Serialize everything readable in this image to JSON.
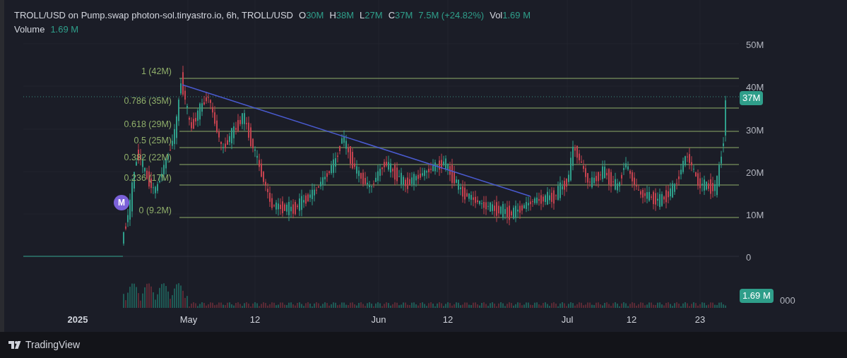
{
  "legend": {
    "title": "TROLL/USD on Pump.swap photon-sol.tinyastro.io, 6h, TROLL/USD",
    "ohlc": [
      {
        "label": "O",
        "value": "30M"
      },
      {
        "label": "H",
        "value": "38M"
      },
      {
        "label": "L",
        "value": "27M"
      },
      {
        "label": "C",
        "value": "37M"
      }
    ],
    "change": "7.5M (+24.82%)",
    "volume": {
      "label": "Vol",
      "value": "1.69 M"
    }
  },
  "volume_legend": {
    "label": "Volume",
    "value": "1.69 M"
  },
  "y_axis": [
    "50M",
    "40M",
    "30M",
    "20M",
    "10M",
    "0"
  ],
  "fib_levels": [
    "1 (42M)",
    "0.786 (35M)",
    "0.618 (29M)",
    "0.5 (25M)",
    "0.382 (22M)",
    "0.236 (17M)",
    "0 (9.2M)"
  ],
  "price_badge": "37M",
  "volume_badge": "1.69 M",
  "volume_axis_tail": "000",
  "marker": "M",
  "x_axis": [
    "2025",
    "May",
    "12",
    "Jun",
    "12",
    "Jul",
    "12",
    "23"
  ],
  "footer": {
    "brand": "TradingView"
  }
}
